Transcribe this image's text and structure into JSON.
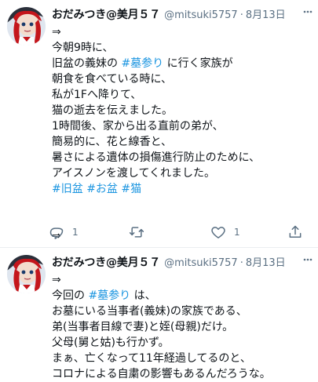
{
  "tweets": [
    {
      "display_name": "おだみつき@美月５７",
      "handle": "@mitsuki5757",
      "separator": "·",
      "date": "8月13日",
      "lines": [
        [
          {
            "t": "⇒"
          }
        ],
        [
          {
            "t": "今朝9時に、"
          }
        ],
        [
          {
            "t": "旧盆の義妹の "
          },
          {
            "t": "#墓参り",
            "tag": true
          },
          {
            "t": " に行く家族が"
          }
        ],
        [
          {
            "t": "朝食を食べている時に、"
          }
        ],
        [
          {
            "t": "私が1Fへ降りて、"
          }
        ],
        [
          {
            "t": "猫の逝去を伝えました。"
          }
        ],
        [
          {
            "t": "1時間後、家から出る直前の弟が、"
          }
        ],
        [
          {
            "t": "簡易的に、花と線香と、"
          }
        ],
        [
          {
            "t": "暑さによる遺体の損傷進行防止のために、"
          }
        ],
        [
          {
            "t": "アイスノンを渡してくれました。"
          }
        ],
        [
          {
            "t": "#旧盆",
            "tag": true
          },
          {
            "t": " "
          },
          {
            "t": "#お盆",
            "tag": true
          },
          {
            "t": " "
          },
          {
            "t": "#猫",
            "tag": true
          }
        ],
        [],
        [],
        [
          {
            "t": "⇒"
          }
        ]
      ],
      "actions": {
        "reply_count": "1",
        "retweet_count": "",
        "like_count": "1",
        "reply_icon": "reply-icon",
        "retweet_icon": "retweet-icon",
        "like_icon": "heart-icon",
        "share_icon": "share-icon"
      }
    },
    {
      "display_name": "おだみつき@美月５７",
      "handle": "@mitsuki5757",
      "separator": "·",
      "date": "8月13日",
      "lines": [
        [
          {
            "t": "⇒"
          }
        ],
        [
          {
            "t": "今回の "
          },
          {
            "t": "#墓参り",
            "tag": true
          },
          {
            "t": " は、"
          }
        ],
        [
          {
            "t": "お墓にいる当事者(義妹)の家族である、"
          }
        ],
        [
          {
            "t": "弟(当事者目線で妻)と姪(母親)だけ。"
          }
        ],
        [
          {
            "t": "父母(舅と姑)も行かず。"
          }
        ],
        [
          {
            "t": "まぁ、亡くなって11年経過してるのと、"
          }
        ],
        [
          {
            "t": "コロナによる自粛の影響もあるんだろうな。"
          }
        ]
      ]
    }
  ],
  "colors": {
    "text": "#0f1419",
    "secondary": "#5b7083",
    "hashtag": "#1b95e0",
    "divider": "#ebeef0"
  }
}
